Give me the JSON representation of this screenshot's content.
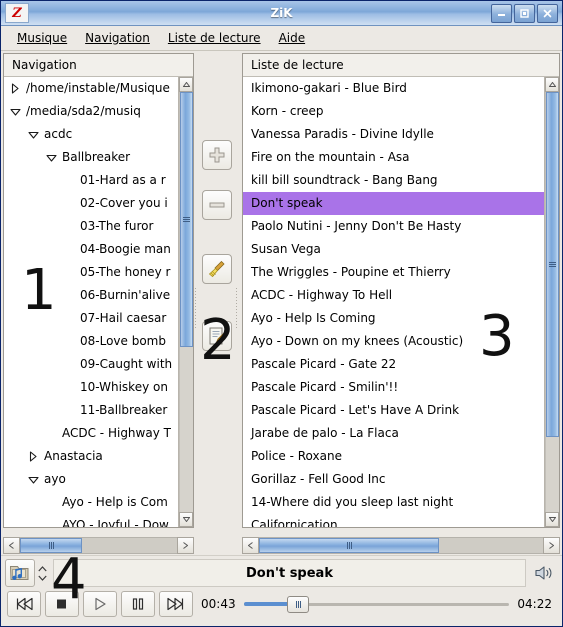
{
  "window": {
    "title": "ZiK",
    "logo_letter": "Z",
    "buttons": [
      {
        "name": "minimize-button",
        "glyph": "minimize"
      },
      {
        "name": "maximize-button",
        "glyph": "maximize"
      },
      {
        "name": "close-button",
        "glyph": "close"
      }
    ]
  },
  "menu": {
    "items": [
      {
        "label": "Musique",
        "accel": "M"
      },
      {
        "label": "Navigation",
        "accel": "N"
      },
      {
        "label": "Liste de lecture",
        "accel": "L"
      },
      {
        "label": "Aide",
        "accel": "e"
      }
    ]
  },
  "navigation": {
    "header": "Navigation",
    "rows": [
      {
        "label": "/home/instable/Musique",
        "indent": 0,
        "twisty": "collapsed"
      },
      {
        "label": "/media/sda2/musiq",
        "indent": 0,
        "twisty": "expanded"
      },
      {
        "label": "acdc",
        "indent": 1,
        "twisty": "expanded"
      },
      {
        "label": "Ballbreaker",
        "indent": 2,
        "twisty": "expanded"
      },
      {
        "label": "01-Hard as a r",
        "indent": 3,
        "twisty": "none"
      },
      {
        "label": "02-Cover you i",
        "indent": 3,
        "twisty": "none"
      },
      {
        "label": "03-The furor",
        "indent": 3,
        "twisty": "none"
      },
      {
        "label": "04-Boogie man",
        "indent": 3,
        "twisty": "none"
      },
      {
        "label": "05-The honey r",
        "indent": 3,
        "twisty": "none"
      },
      {
        "label": "06-Burnin'alive",
        "indent": 3,
        "twisty": "none"
      },
      {
        "label": "07-Hail caesar",
        "indent": 3,
        "twisty": "none"
      },
      {
        "label": "08-Love bomb",
        "indent": 3,
        "twisty": "none"
      },
      {
        "label": "09-Caught with",
        "indent": 3,
        "twisty": "none"
      },
      {
        "label": "10-Whiskey on",
        "indent": 3,
        "twisty": "none"
      },
      {
        "label": "11-Ballbreaker",
        "indent": 3,
        "twisty": "none"
      },
      {
        "label": "ACDC - Highway T",
        "indent": 2,
        "twisty": "none"
      },
      {
        "label": "Anastacia",
        "indent": 1,
        "twisty": "collapsed"
      },
      {
        "label": "ayo",
        "indent": 1,
        "twisty": "expanded"
      },
      {
        "label": "Ayo - Help is Com",
        "indent": 2,
        "twisty": "none"
      },
      {
        "label": "AYO - Joyful - Dow",
        "indent": 2,
        "twisty": "none"
      }
    ]
  },
  "toolbar": {
    "buttons": [
      {
        "name": "add-button",
        "icon": "plus-icon"
      },
      {
        "name": "remove-button",
        "icon": "minus-icon"
      },
      {
        "name": "clear-button",
        "icon": "broom-icon"
      },
      {
        "name": "edit-button",
        "icon": "document-edit-icon"
      }
    ]
  },
  "playlist": {
    "header": "Liste de lecture",
    "selected_index": 5,
    "rows": [
      "Ikimono-gakari - Blue Bird",
      "Korn - creep",
      "Vanessa Paradis - Divine Idylle",
      "Fire on the mountain - Asa",
      "kill bill soundtrack - Bang Bang",
      "Don't speak",
      "Paolo Nutini - Jenny Don't Be Hasty",
      "Susan Vega",
      "The Wriggles - Poupine et Thierry",
      "ACDC - Highway To Hell",
      "Ayo - Help Is Coming",
      "Ayo - Down on my knees (Acoustic)",
      "Pascale Picard - Gate 22",
      "Pascale Picard - Smilin'!!",
      "Pascale Picard - Let's Have A Drink",
      "Jarabe de palo - La Flaca",
      "Police - Roxane",
      "Gorillaz - Fell Good Inc",
      "14-Where did you sleep last night",
      "Californication"
    ]
  },
  "player": {
    "now_playing": "Don't speak",
    "elapsed": "00:43",
    "duration": "04:22",
    "progress_percent": 16,
    "open_icon": "music-folder-icon",
    "volume_icon": "speaker-icon",
    "transport": [
      {
        "name": "previous-button",
        "icon": "previous-icon"
      },
      {
        "name": "stop-button",
        "icon": "stop-icon"
      },
      {
        "name": "play-button",
        "icon": "play-icon"
      },
      {
        "name": "pause-button",
        "icon": "pause-icon"
      },
      {
        "name": "next-button",
        "icon": "next-icon"
      }
    ]
  },
  "annotations": [
    {
      "label": "1",
      "region": "navigation-pane"
    },
    {
      "label": "2",
      "region": "middle-toolbar"
    },
    {
      "label": "3",
      "region": "playlist-pane"
    },
    {
      "label": "4",
      "region": "player-bar"
    }
  ],
  "colors": {
    "selection": "#a973e8",
    "titlebar": "#7ea7d8",
    "scrollbar_thumb": "#7ba7da",
    "seek_fill": "#5b8fd0",
    "logo": "#cc0000"
  }
}
